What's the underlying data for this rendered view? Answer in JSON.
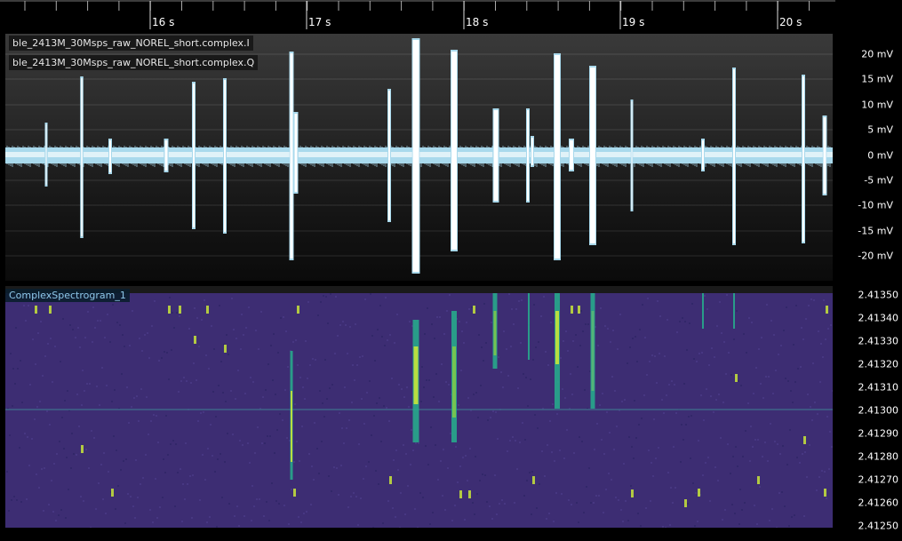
{
  "time_axis": {
    "ticks": [
      "16 s",
      "17 s",
      "18 s",
      "19 s",
      "20 s"
    ]
  },
  "waveform": {
    "trace_i": "ble_2413M_30Msps_raw_NOREL_short.complex.I",
    "trace_q": "ble_2413M_30Msps_raw_NOREL_short.complex.Q",
    "y_labels": [
      "20 mV",
      "15 mV",
      "10 mV",
      "5 mV",
      "0 mV",
      "-5 mV",
      "-10 mV",
      "-15 mV",
      "-20 mV"
    ],
    "trace_color": "#a9d9ec"
  },
  "spectrogram": {
    "title": "ComplexSpectrogram_1",
    "y_labels": [
      "2.41350",
      "2.41340",
      "2.41330",
      "2.41320",
      "2.41310",
      "2.41300",
      "2.41290",
      "2.41280",
      "2.41270",
      "2.41260",
      "2.41250"
    ],
    "background_color": "#3d2d73",
    "signal_color": "#27a88c",
    "peak_color": "#c8e63a"
  }
}
